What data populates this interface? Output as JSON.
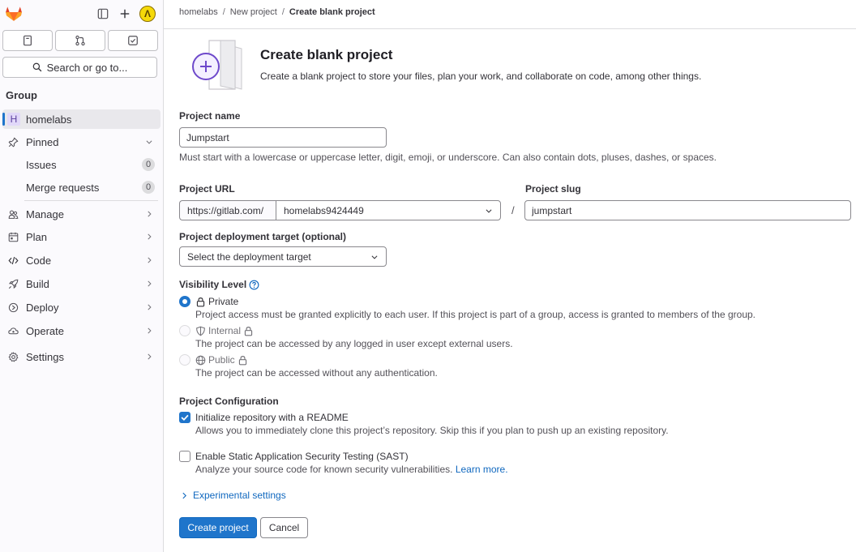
{
  "sidebar": {
    "search_label": "Search or go to...",
    "group_label": "Group",
    "current_group": {
      "initial": "H",
      "label": "homelabs"
    },
    "pinned": {
      "label": "Pinned",
      "items": [
        {
          "label": "Issues",
          "count": "0"
        },
        {
          "label": "Merge requests",
          "count": "0"
        }
      ]
    },
    "nav": [
      {
        "label": "Manage",
        "icon": "users-icon"
      },
      {
        "label": "Plan",
        "icon": "planning-icon"
      },
      {
        "label": "Code",
        "icon": "code-icon"
      },
      {
        "label": "Build",
        "icon": "rocket-icon"
      },
      {
        "label": "Deploy",
        "icon": "deploy-icon"
      },
      {
        "label": "Operate",
        "icon": "cloud-icon"
      },
      {
        "label": "Settings",
        "icon": "gear-icon"
      }
    ],
    "avatar_initial": "Λ"
  },
  "breadcrumb": {
    "items": [
      "homelabs",
      "New project"
    ],
    "current": "Create blank project",
    "sep": "/"
  },
  "header": {
    "title": "Create blank project",
    "description": "Create a blank project to store your files, plan your work, and collaborate on code, among other things."
  },
  "form": {
    "project_name": {
      "label": "Project name",
      "value": "Jumpstart",
      "help": "Must start with a lowercase or uppercase letter, digit, emoji, or underscore. Can also contain dots, pluses, dashes, or spaces."
    },
    "project_url": {
      "label": "Project URL",
      "prefix": "https://gitlab.com/",
      "namespace": "homelabs9424449",
      "separator": "/"
    },
    "project_slug": {
      "label": "Project slug",
      "value": "jumpstart"
    },
    "deployment_target": {
      "label": "Project deployment target (optional)",
      "placeholder": "Select the deployment target"
    },
    "visibility": {
      "label": "Visibility Level",
      "options": [
        {
          "label": "Private",
          "help": "Project access must be granted explicitly to each user. If this project is part of a group, access is granted to members of the group.",
          "checked": true,
          "disabled": false
        },
        {
          "label": "Internal",
          "help": "The project can be accessed by any logged in user except external users.",
          "checked": false,
          "disabled": true
        },
        {
          "label": "Public",
          "help": "The project can be accessed without any authentication.",
          "checked": false,
          "disabled": true
        }
      ]
    },
    "configuration": {
      "label": "Project Configuration",
      "readme": {
        "label": "Initialize repository with a README",
        "help": "Allows you to immediately clone this project’s repository. Skip this if you plan to push up an existing repository.",
        "checked": true
      },
      "sast": {
        "label": "Enable Static Application Security Testing (SAST)",
        "help": "Analyze your source code for known security vulnerabilities.",
        "link": "Learn more.",
        "checked": false
      }
    },
    "experimental": "Experimental settings",
    "submit": "Create project",
    "cancel": "Cancel"
  },
  "colors": {
    "primary": "#1f75cb",
    "link": "#1068bf",
    "illustration": "#6e49cb"
  }
}
